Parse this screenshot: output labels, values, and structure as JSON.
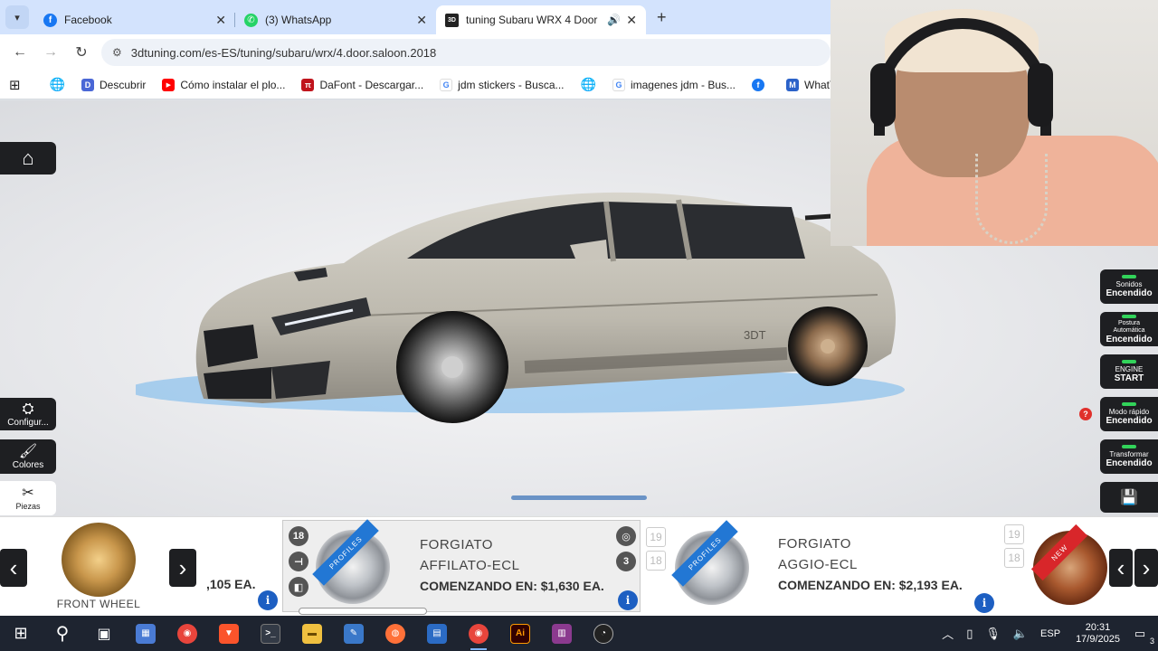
{
  "browser": {
    "tabs": [
      {
        "label": "Facebook",
        "icon": "facebook-icon",
        "color": "#1877f2",
        "glyph": "f",
        "active": false
      },
      {
        "label": "(3) WhatsApp",
        "icon": "whatsapp-icon",
        "color": "#25d366",
        "glyph": "✆",
        "active": false
      },
      {
        "label": "tuning Subaru WRX 4 Door",
        "icon": "3dtuning-icon",
        "color": "#222222",
        "glyph": "3D",
        "active": true
      }
    ],
    "new_tab": "+",
    "url": "3dtuning.com/es-ES/tuning/subaru/wrx/4.door.saloon.2018",
    "bookmarks": [
      {
        "label": "Descubrir",
        "icon": "discover-icon",
        "color": "#4a67d6",
        "glyph": "D"
      },
      {
        "label": "Cómo instalar el plo...",
        "icon": "youtube-icon",
        "color": "#ff0000",
        "glyph": "▶"
      },
      {
        "label": "DaFont - Descargar...",
        "icon": "dafont-icon",
        "color": "#c0141c",
        "glyph": "π"
      },
      {
        "label": "jdm stickers - Busca...",
        "icon": "google-icon",
        "color": "#ffffff",
        "glyph": "G"
      },
      {
        "label": "imagenes jdm - Bus...",
        "icon": "google-icon",
        "color": "#ffffff",
        "glyph": "G"
      },
      {
        "label": "WhatTheFont! « M",
        "icon": "whatthefont-icon",
        "color": "#2b62c9",
        "glyph": "M"
      }
    ]
  },
  "left_menu": {
    "config": "Configur...",
    "colors": "Colores",
    "parts": "Piezas"
  },
  "right_menu": [
    {
      "line1": "Sonidos",
      "line2": "Encendido"
    },
    {
      "line1": "Postura Automática",
      "line2": "Encendido"
    },
    {
      "line1": "ENGINE",
      "line2": "START"
    },
    {
      "line1": "Modo rápido",
      "line2": "Encendido"
    },
    {
      "line1": "Transformar",
      "line2": "Encendido"
    }
  ],
  "help_badge": "?",
  "car": {
    "watermark": "3DT"
  },
  "strip": {
    "category_label": "FRONT WHEEL",
    "prev_price_partial": ",105 EA.",
    "selected": {
      "sizes": [
        "18",
        "19",
        "18"
      ],
      "brand": "FORGIATO",
      "model": "AFFILATO-ECL",
      "price": "COMENZANDO EN: $1,630 EA.",
      "ribbon": "PROFILES"
    },
    "next": {
      "sizes": [
        "19",
        "18"
      ],
      "brand": "FORGIATO",
      "model": "AGGIO-ECL",
      "price": "COMENZANDO EN: $2,193 EA.",
      "ribbon": "PROFILES"
    },
    "last": {
      "sizes": [
        "19",
        "18"
      ],
      "ribbon": "NEW"
    },
    "info_glyph": "i"
  },
  "taskbar": {
    "apps": [
      {
        "name": "calculator-icon",
        "color": "#4a7bd4",
        "glyph": "▦"
      },
      {
        "name": "chrome-icon",
        "color": "#e8453c",
        "glyph": "◉"
      },
      {
        "name": "brave-icon",
        "color": "#fb542b",
        "glyph": "▼"
      },
      {
        "name": "terminal-icon",
        "color": "#333a46",
        "glyph": ">_"
      },
      {
        "name": "file-explorer-icon",
        "color": "#f0c040",
        "glyph": "▬"
      },
      {
        "name": "notepad-icon",
        "color": "#3a78c9",
        "glyph": "✎"
      },
      {
        "name": "firefox-icon",
        "color": "#ff7139",
        "glyph": "◍"
      },
      {
        "name": "app-icon",
        "color": "#2b6bc4",
        "glyph": "▤"
      },
      {
        "name": "chrome-active-icon",
        "color": "#e8453c",
        "glyph": "◉"
      },
      {
        "name": "illustrator-icon",
        "color": "#330000",
        "glyph": "Ai"
      },
      {
        "name": "winrar-icon",
        "color": "#8b3a8f",
        "glyph": "▥"
      },
      {
        "name": "speedtest-icon",
        "color": "#222222",
        "glyph": "◔"
      }
    ],
    "lang": "ESP",
    "time": "20:31",
    "date": "17/9/2025",
    "notifications": "3"
  }
}
